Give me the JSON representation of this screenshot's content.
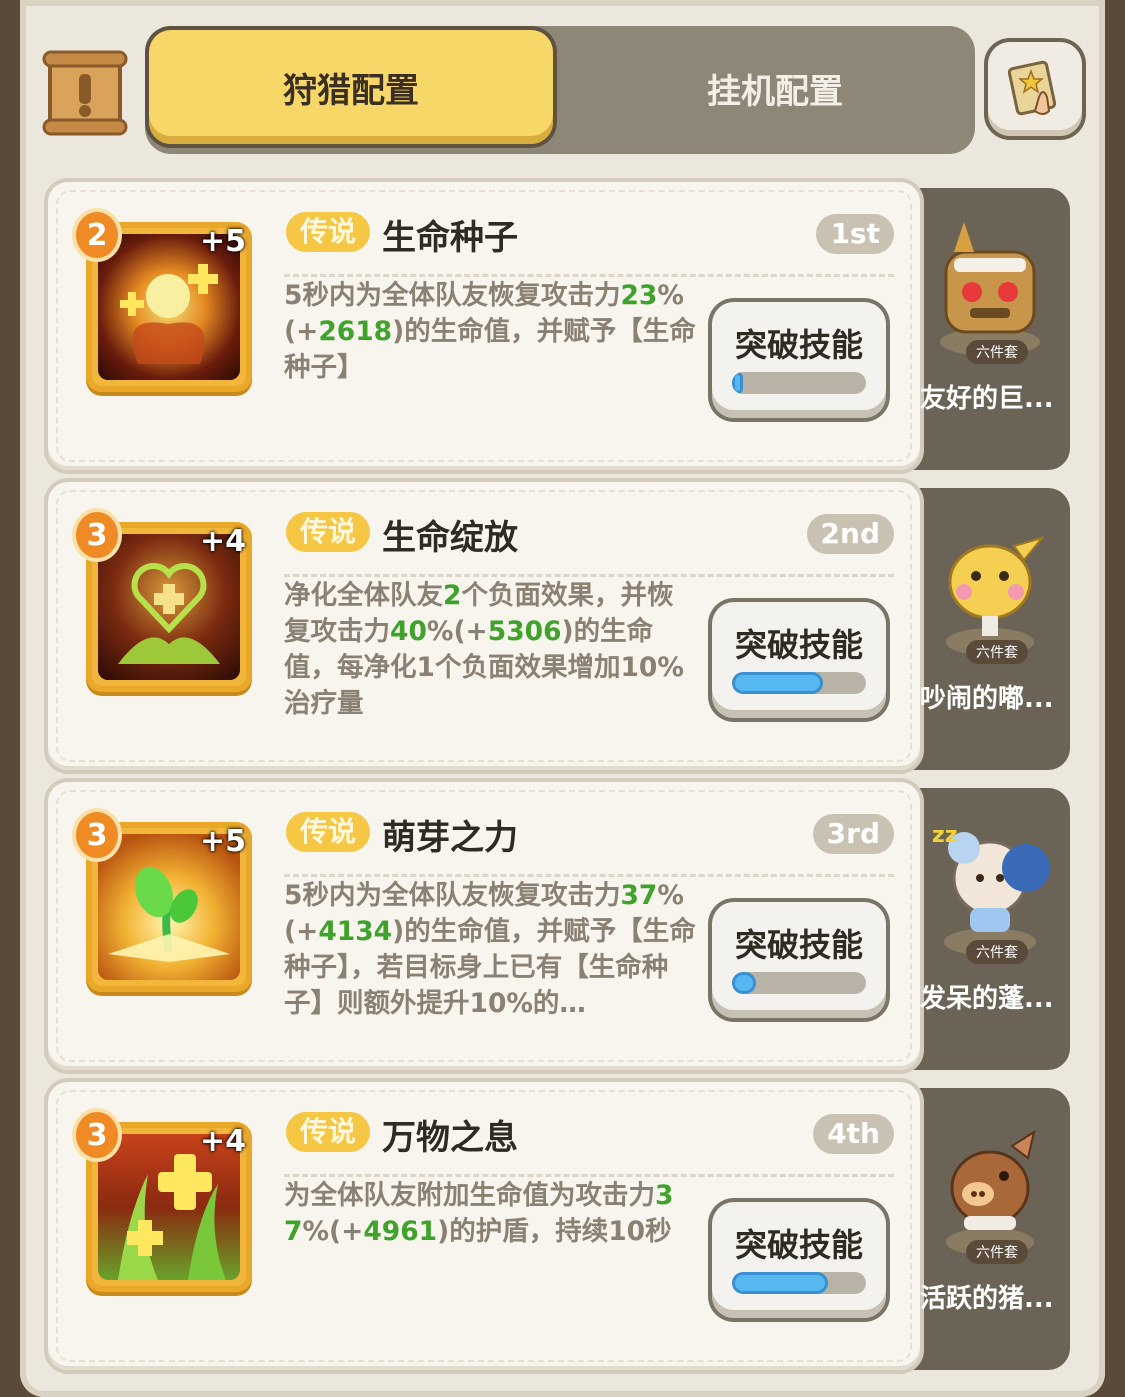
{
  "header": {
    "tab_active": "狩猎配置",
    "tab_inactive": "挂机配置"
  },
  "skills": [
    {
      "level": "2",
      "plus": "+5",
      "badge": "传说",
      "name": "生命种子",
      "rank": "1st",
      "desc_parts": [
        "5秒内为全体队友恢复攻击力",
        "23",
        "%(+",
        "2618",
        ")的生命值，并赋予【生命种子】"
      ],
      "button": "突破技能",
      "progress": 0.08,
      "pet_name": "友好的巨...",
      "set_tag": "六件套"
    },
    {
      "level": "3",
      "plus": "+4",
      "badge": "传说",
      "name": "生命绽放",
      "rank": "2nd",
      "desc_parts": [
        "净化全体队友",
        "2",
        "个负面效果，并恢复攻击力",
        "40",
        "%(+",
        "5306",
        ")的生命值，每净化1个负面效果增加10%治疗量"
      ],
      "button": "突破技能",
      "progress": 0.68,
      "pet_name": "吵闹的嘟...",
      "set_tag": "六件套"
    },
    {
      "level": "3",
      "plus": "+5",
      "badge": "传说",
      "name": "萌芽之力",
      "rank": "3rd",
      "desc_parts": [
        "5秒内为全体队友恢复攻击力",
        "37",
        "%(+",
        "4134",
        ")的生命值，并赋予【生命种子】，若目标身上已有【生命种子】则额外提升10%的…"
      ],
      "button": "突破技能",
      "progress": 0.18,
      "pet_name": "发呆的蓬...",
      "set_tag": "六件套"
    },
    {
      "level": "3",
      "plus": "+4",
      "badge": "传说",
      "name": "万物之息",
      "rank": "4th",
      "desc_parts": [
        "为全体队友附加生命值为攻击力",
        "37",
        "%(+",
        "4961",
        ")的护盾，持续10秒"
      ],
      "button": "突破技能",
      "progress": 0.72,
      "pet_name": "活跃的猪...",
      "set_tag": "六件套"
    }
  ],
  "colors": {
    "accent_gold": "#f6d768",
    "highlight_green": "#3fa22b",
    "progress_blue": "#56b8f0"
  },
  "icons": [
    "scroll-icon",
    "guide-card-icon",
    "seed-icon",
    "heart-flower-icon",
    "sprout-icon",
    "leaf-cross-icon"
  ]
}
